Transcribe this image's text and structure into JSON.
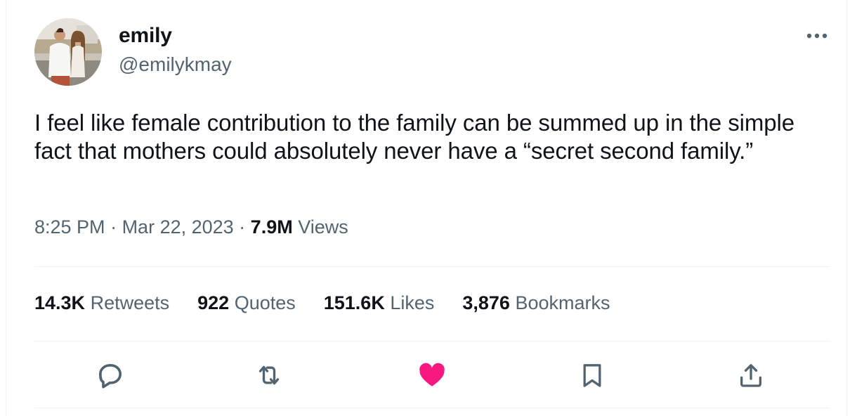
{
  "author": {
    "name": "emily",
    "handle": "@emilykmay"
  },
  "tweet": {
    "text": "I feel like female contribution to the family can be summed up in the simple fact that mothers could absolutely never have a “secret second family.”",
    "time": "8:25 PM",
    "separator": " · ",
    "date": "Mar 22, 2023",
    "views_count": "7.9M",
    "views_label": " Views"
  },
  "stats": {
    "retweets": {
      "count": "14.3K",
      "label": " Retweets"
    },
    "quotes": {
      "count": "922",
      "label": " Quotes"
    },
    "likes": {
      "count": "151.6K",
      "label": " Likes"
    },
    "bookmarks": {
      "count": "3,876",
      "label": " Bookmarks"
    }
  },
  "actions": [
    "reply-icon",
    "retweet-icon",
    "like-icon",
    "bookmark-icon",
    "share-icon"
  ],
  "colors": {
    "text": "#0f1419",
    "secondary": "#536471",
    "like_active": "#f91880",
    "divider": "#eff3f4"
  },
  "state": {
    "liked": true
  }
}
